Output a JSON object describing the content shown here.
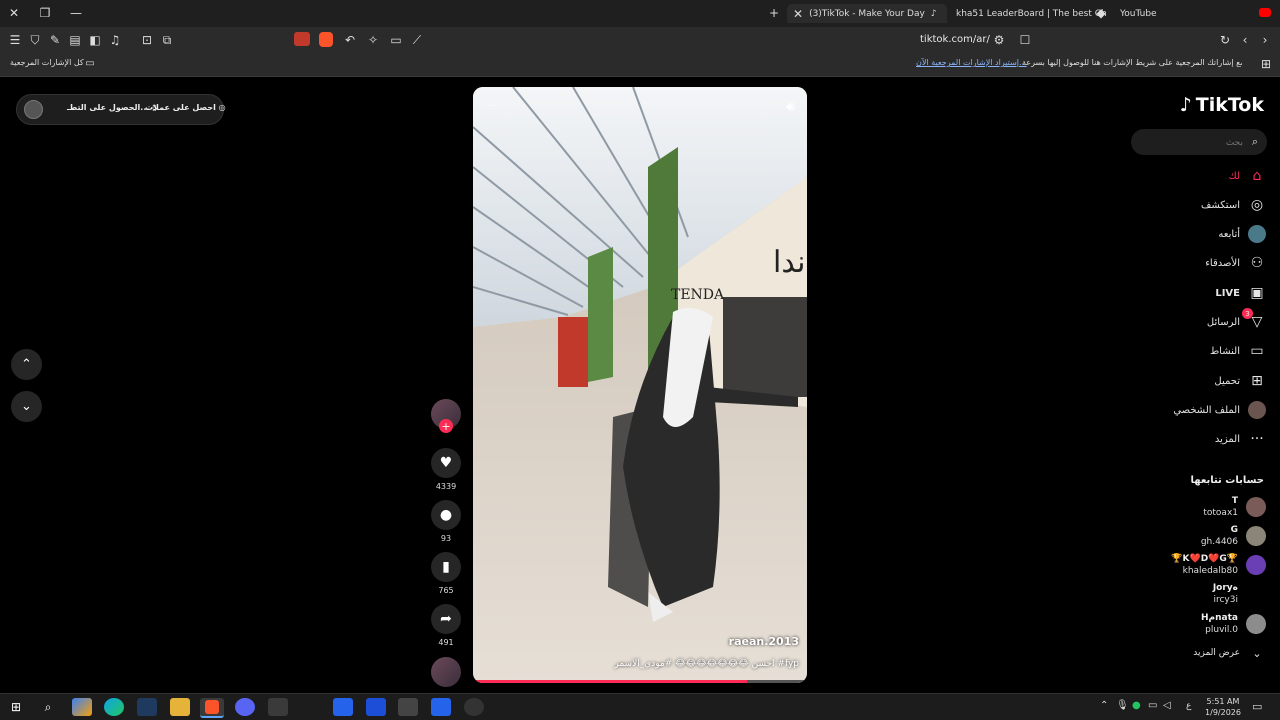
{
  "browser": {
    "tabs": [
      {
        "label": "(3)TikTok - Make Your Day"
      },
      {
        "label": "kha51 LeaderBoard | The best ChatB..."
      },
      {
        "label": "YouTube"
      }
    ],
    "url": "tiktok.com/ar/",
    "bookmarks": {
      "all_label": "كل الإشارات المرجعية",
      "prompt_text": "ضع إشاراتك المرجعية على شريط الإشارات هنا للوصول إليها بسرعة.",
      "import_link": "إستيراد الإشارات المرجعية الآن..."
    }
  },
  "tiktok": {
    "logo": "TikTok",
    "search_placeholder": "بحث",
    "top_actions": {
      "get_coins": "احصل على عملات",
      "get_app": "الحصول على التطـ..."
    },
    "nav": [
      {
        "label": "لك",
        "icon": "home-icon"
      },
      {
        "label": "استكشف",
        "icon": "compass-icon"
      },
      {
        "label": "أتابعه",
        "icon": "avatar-icon"
      },
      {
        "label": "الأصدقاء",
        "icon": "friends-icon"
      },
      {
        "label": "LIVE",
        "icon": "live-icon"
      },
      {
        "label": "الرسائل",
        "icon": "messages-icon",
        "badge": "3"
      },
      {
        "label": "النشاط",
        "icon": "activity-icon"
      },
      {
        "label": "تحميل",
        "icon": "upload-icon"
      },
      {
        "label": "الملف الشخصي",
        "icon": "profile-icon"
      },
      {
        "label": "المزيد",
        "icon": "more-icon"
      }
    ],
    "following_title": "حسابات تتابعها",
    "following": [
      {
        "display": "T",
        "handle": "totoax1"
      },
      {
        "display": "G",
        "handle": "gh.4406"
      },
      {
        "display": "🏆K❤️D❤️G🏆",
        "handle": "khaledalb80"
      },
      {
        "display": "Joryه",
        "handle": "ircy3i"
      },
      {
        "display": "Hمnata",
        "handle": "pluvil.0"
      }
    ],
    "see_more": "عرض المزيد",
    "video": {
      "username": "raean.2013",
      "caption": "احسن 😂😂😂😂😂😂😂 #مودي_الاسمر #fyp",
      "progress": 0.82
    },
    "actions": {
      "likes": "4339",
      "comments": "93",
      "saves": "765",
      "shares": "491"
    }
  },
  "taskbar": {
    "time": "5:51 AM",
    "date": "1/9/2026",
    "lang": "ع"
  },
  "colors": {
    "accent": "#fe2c55",
    "link": "#8ab4f8"
  }
}
